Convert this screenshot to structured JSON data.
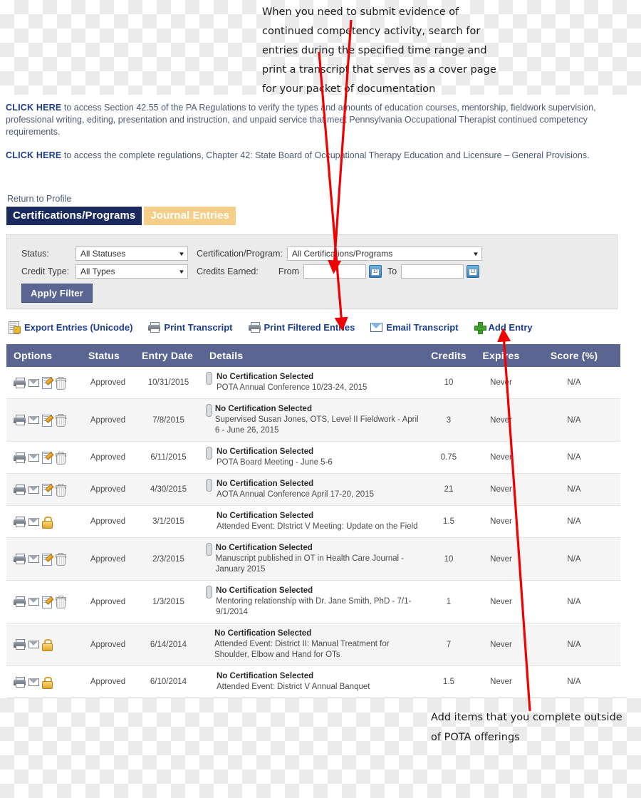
{
  "annotations": {
    "top": "When you need to submit evidence of continued competency activity, search for entries during the specified time range and print a transcript that serves as a cover page for your packet of documentation",
    "bottom": "Add items that you complete outside of POTA offerings"
  },
  "intro": {
    "link_label": "CLICK HERE",
    "paragraph1": " to access Section 42.55 of the PA Regulations to verify the types and amounts of education courses, mentorship, fieldwork supervision, professional writing, editing, presentation and instruction, and unpaid service that meet Pennsylvania Occupational Therapist continued competency requirements.",
    "paragraph2": " to access the complete regulations, Chapter 42: State Board of Occupational Therapy Education and Licensure – General Provisions."
  },
  "return_link": "Return to Profile",
  "tabs": [
    {
      "label": "Certifications/Programs",
      "active": true
    },
    {
      "label": "Journal Entries",
      "active": false
    }
  ],
  "filter": {
    "status_label": "Status:",
    "status_value": "All Statuses",
    "cert_label": "Certification/Program:",
    "cert_value": "All Certifications/Programs",
    "credit_type_label": "Credit Type:",
    "credit_type_value": "All Types",
    "credits_earned_label": "Credits Earned:",
    "from_label": "From",
    "from_value": "",
    "to_label": "To",
    "to_value": "",
    "apply_label": "Apply Filter"
  },
  "toolbar": [
    {
      "label": "Export Entries (Unicode)",
      "icon": "export-icon"
    },
    {
      "label": "Print Transcript",
      "icon": "printer-icon"
    },
    {
      "label": "Print Filtered Entries",
      "icon": "printer-icon"
    },
    {
      "label": "Email Transcript",
      "icon": "mail-icon"
    },
    {
      "label": "Add Entry",
      "icon": "plus-icon"
    }
  ],
  "table": {
    "columns": [
      "Options",
      "Status",
      "Entry Date",
      "Details",
      "Credits",
      "Expires",
      "Score (%)"
    ],
    "rows": [
      {
        "icons": [
          "printer-icon",
          "mail-icon",
          "edit-icon",
          "trash-icon"
        ],
        "has_attachment": true,
        "status": "Approved",
        "entry_date": "10/31/2015",
        "detail_title": "No Certification Selected",
        "detail_sub": "POTA Annual Conference 10/23-24, 2015",
        "credits": "10",
        "expires": "Never",
        "score": "N/A"
      },
      {
        "icons": [
          "printer-icon",
          "mail-icon",
          "edit-icon",
          "trash-icon"
        ],
        "has_attachment": true,
        "status": "Approved",
        "entry_date": "7/8/2015",
        "detail_title": "No Certification Selected",
        "detail_sub": "Supervised Susan Jones, OTS, Level II Fieldwork - April 6 - June 26, 2015",
        "credits": "3",
        "expires": "Never",
        "score": "N/A"
      },
      {
        "icons": [
          "printer-icon",
          "mail-icon",
          "edit-icon",
          "trash-icon"
        ],
        "has_attachment": true,
        "status": "Approved",
        "entry_date": "6/11/2015",
        "detail_title": "No Certification Selected",
        "detail_sub": "POTA Board Meeting - June 5-6",
        "credits": "0.75",
        "expires": "Never",
        "score": "N/A"
      },
      {
        "icons": [
          "printer-icon",
          "mail-icon",
          "edit-icon",
          "trash-icon"
        ],
        "has_attachment": true,
        "status": "Approved",
        "entry_date": "4/30/2015",
        "detail_title": "No Certification Selected",
        "detail_sub": "AOTA Annual Conference April 17-20, 2015",
        "credits": "21",
        "expires": "Never",
        "score": "N/A"
      },
      {
        "icons": [
          "printer-icon",
          "mail-icon",
          "lock-icon"
        ],
        "has_attachment": false,
        "status": "Approved",
        "entry_date": "3/1/2015",
        "detail_title": "No Certification Selected",
        "detail_sub": "Attended Event: DIstrict V Meeting: Update on the Field",
        "credits": "1.5",
        "expires": "Never",
        "score": "N/A"
      },
      {
        "icons": [
          "printer-icon",
          "mail-icon",
          "edit-icon",
          "trash-icon"
        ],
        "has_attachment": true,
        "status": "Approved",
        "entry_date": "2/3/2015",
        "detail_title": "No Certification Selected",
        "detail_sub": "Manuscript published in OT in Health Care Journal - January 2015",
        "credits": "10",
        "expires": "Never",
        "score": "N/A"
      },
      {
        "icons": [
          "printer-icon",
          "mail-icon",
          "edit-icon",
          "trash-icon"
        ],
        "has_attachment": true,
        "status": "Approved",
        "entry_date": "1/3/2015",
        "detail_title": "No Certification Selected",
        "detail_sub": "Mentoring relationship with Dr. Jane Smith, PhD - 7/1-9/1/2014",
        "credits": "1",
        "expires": "Never",
        "score": "N/A"
      },
      {
        "icons": [
          "printer-icon",
          "mail-icon",
          "lock-icon"
        ],
        "has_attachment": false,
        "status": "Approved",
        "entry_date": "6/14/2014",
        "detail_title": "No Certification Selected",
        "detail_sub": "Attended Event: District II: Manual Treatment for Shoulder, Elbow and Hand for OTs",
        "credits": "7",
        "expires": "Never",
        "score": "N/A"
      },
      {
        "icons": [
          "printer-icon",
          "mail-icon",
          "lock-icon"
        ],
        "has_attachment": false,
        "status": "Approved",
        "entry_date": "6/10/2014",
        "detail_title": "No Certification Selected",
        "detail_sub": "Attended Event: District V Annual Banquet",
        "credits": "1.5",
        "expires": "Never",
        "score": "N/A"
      }
    ]
  },
  "colors": {
    "active_tab": "#1b2a5e",
    "inactive_tab": "#f5cf87",
    "table_header": "#5a6591",
    "link_blue": "#1d3d8f",
    "annotation_arrow": "#f00000"
  }
}
